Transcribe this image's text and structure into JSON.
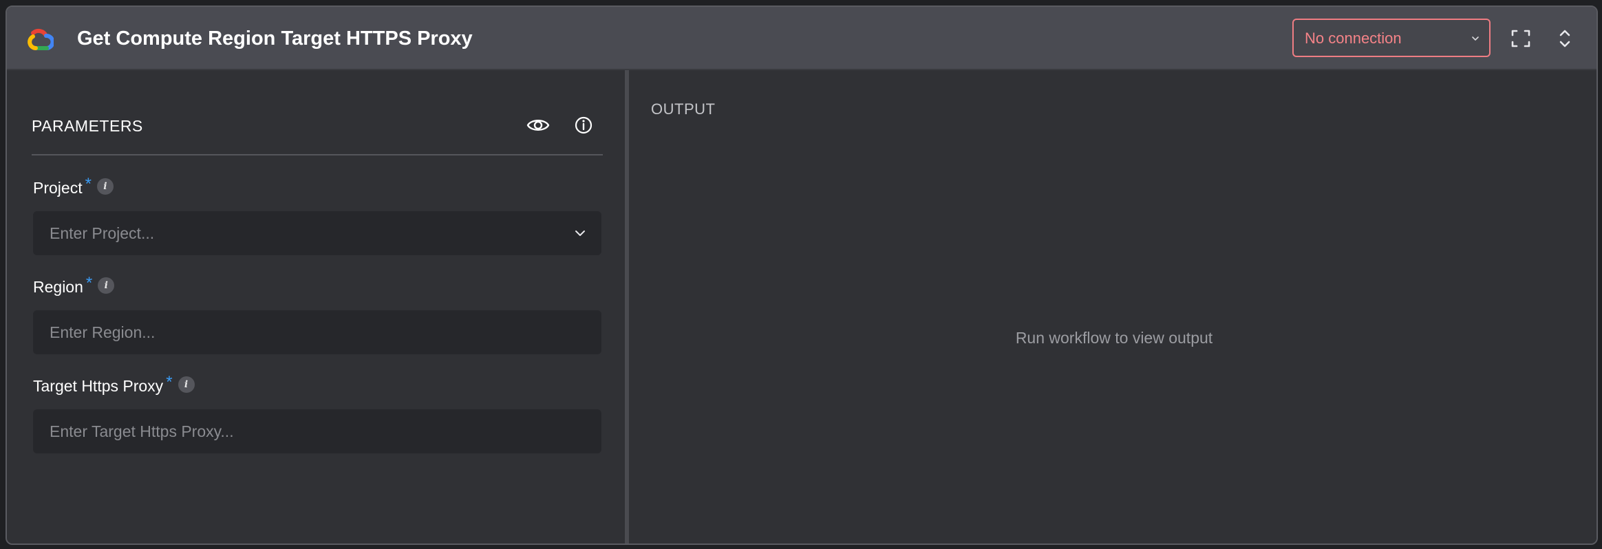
{
  "header": {
    "title": "Get Compute Region Target HTTPS Proxy",
    "logo_icon": "google-cloud-logo-icon",
    "connection": {
      "selected": "No connection",
      "status_color": "#f58388"
    },
    "actions": {
      "expand_icon": "fullscreen-icon",
      "collapse_icon": "chevron-up-down-icon"
    }
  },
  "parameters": {
    "title": "PARAMETERS",
    "preview_icon": "eye-icon",
    "info_icon": "info-icon",
    "fields": [
      {
        "label": "Project",
        "required_mark": "*",
        "info_glyph": "i",
        "placeholder": "Enter Project...",
        "type": "select",
        "value": ""
      },
      {
        "label": "Region",
        "required_mark": "*",
        "info_glyph": "i",
        "placeholder": "Enter Region...",
        "type": "text",
        "value": ""
      },
      {
        "label": "Target Https Proxy",
        "required_mark": "*",
        "info_glyph": "i",
        "placeholder": "Enter Target Https Proxy...",
        "type": "text",
        "value": ""
      }
    ]
  },
  "output": {
    "title": "OUTPUT",
    "empty_message": "Run workflow to view output"
  },
  "colors": {
    "header_bg": "#4a4b52",
    "panel_bg": "#303135",
    "input_bg": "#26272b",
    "required_accent": "#3b9cf5",
    "error_border": "#ef7d83"
  }
}
